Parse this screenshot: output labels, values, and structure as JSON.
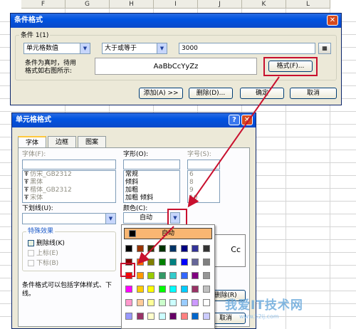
{
  "sheet": {
    "columns": [
      "F",
      "G",
      "H",
      "I",
      "J",
      "K",
      "L"
    ]
  },
  "cond_dialog": {
    "title": "条件格式",
    "close_icon": "close-icon",
    "group_label": "条件 1(1)",
    "type_select": "单元格数值",
    "operator_select": "大于或等于",
    "value_input": "3000",
    "preview_label_1": "条件为真时，待用",
    "preview_label_2": "格式如右图所示:",
    "preview_sample": "AaBbCcYyZz",
    "format_button": "格式(F)...",
    "add_button": "添加(A) >>",
    "delete_button": "删除(D)...",
    "ok_button": "确定",
    "cancel_button": "取消"
  },
  "cell_dialog": {
    "title": "单元格格式",
    "help_icon": "help-icon",
    "close_icon": "close-icon",
    "tabs": [
      "字体",
      "边框",
      "图案"
    ],
    "font_label": "字体(F):",
    "style_label": "字形(O):",
    "size_label": "字号(S):",
    "font_list": [
      "仿宋_GB2312",
      "黑体",
      "楷体_GB2312",
      "宋体"
    ],
    "style_list": [
      "常规",
      "倾斜",
      "加粗",
      "加粗 倾斜"
    ],
    "size_list": [
      "6",
      "8",
      "9",
      "10"
    ],
    "underline_label": "下划线(U):",
    "color_label": "颜色(C):",
    "color_value": "自动",
    "effects_label": "特殊效果",
    "strike_label": "删除线(K)",
    "super_label": "上标(E)",
    "sub_label": "下标(B)",
    "preview_text": "Cc",
    "note_text_1": "条件格式可以包括字体样式、下",
    "note_text_2": "线。",
    "clear_button": "删除(R)",
    "cancel_button": "取消"
  },
  "palette": {
    "auto_label": "自动",
    "auto_bg": "#f9b672",
    "selected_color": "#ff0000",
    "rows": [
      [
        "#000000",
        "#993300",
        "#333300",
        "#003300",
        "#003366",
        "#000080",
        "#333399",
        "#333333"
      ],
      [
        "#800000",
        "#ff6600",
        "#808000",
        "#008000",
        "#008080",
        "#0000ff",
        "#666699",
        "#808080"
      ],
      [
        "#ff0000",
        "#ff9900",
        "#99cc00",
        "#339966",
        "#33cccc",
        "#3366ff",
        "#800080",
        "#969696"
      ],
      [
        "#ff00ff",
        "#ffcc00",
        "#ffff00",
        "#00ff00",
        "#00ffff",
        "#00ccff",
        "#993366",
        "#c0c0c0"
      ],
      [
        "#ff99cc",
        "#ffcc99",
        "#ffff99",
        "#ccffcc",
        "#ccffff",
        "#99ccff",
        "#cc99ff",
        "#ffffff"
      ],
      [
        "#9999ff",
        "#993366",
        "#ffffcc",
        "#ccffff",
        "#660066",
        "#ff8080",
        "#0066cc",
        "#ccccff"
      ]
    ]
  },
  "watermark": {
    "text": "我爱IT技术网",
    "url": "www.52ij.com"
  },
  "colors": {
    "accent_red": "#c8102e",
    "titlebar_blue": "#0053e1",
    "dialog_bg": "#ece9d8"
  }
}
